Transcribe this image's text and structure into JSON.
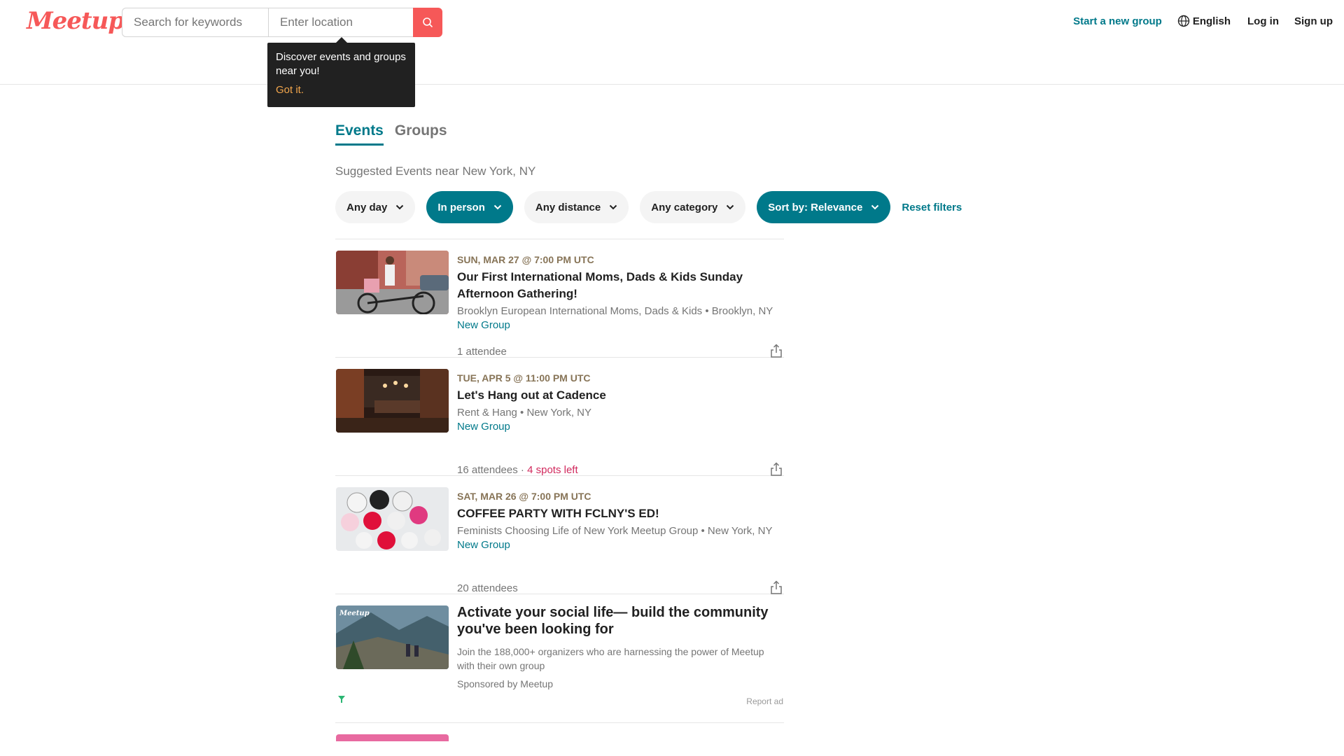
{
  "header": {
    "logo_text": "Meetup",
    "search_placeholder": "Search for keywords",
    "location_placeholder": "Enter location",
    "start_group": "Start a new group",
    "language": "English",
    "login": "Log in",
    "signup": "Sign up"
  },
  "tooltip": {
    "text": "Discover events and groups near you!",
    "action": "Got it."
  },
  "tabs": [
    {
      "label": "Events",
      "active": true
    },
    {
      "label": "Groups",
      "active": false
    }
  ],
  "subtitle": "Suggested Events near New York, NY",
  "filters": {
    "day": "Any day",
    "mode": "In person",
    "distance": "Any distance",
    "category": "Any category",
    "sort": "Sort by: Relevance",
    "reset": "Reset filters"
  },
  "events": [
    {
      "date": "SUN, MAR 27 @ 7:00 PM UTC",
      "title": "Our First International Moms, Dads & Kids Sunday Afternoon Gathering!",
      "group": "Brooklyn European International Moms, Dads & Kids • Brooklyn, NY",
      "badge": "New Group",
      "attendees": "1 attendee",
      "spots": ""
    },
    {
      "date": "TUE, APR 5 @ 11:00 PM UTC",
      "title": "Let's Hang out at Cadence",
      "group": "Rent & Hang • New York, NY",
      "badge": "New Group",
      "attendees": "16 attendees",
      "spots": "4 spots left"
    },
    {
      "date": "SAT, MAR 26 @ 7:00 PM UTC",
      "title": "COFFEE PARTY WITH FCLNY'S ED!",
      "group": "Feminists Choosing Life of New York Meetup Group • New York, NY",
      "badge": "New Group",
      "attendees": "20 attendees",
      "spots": ""
    }
  ],
  "sponsored": {
    "logo_text": "Meetup",
    "title": "Activate your social life— build the community you've been looking for",
    "description": "Join the 188,000+ organizers who are harnessing the power of Meetup with their own group",
    "by": "Sponsored by Meetup",
    "report": "Report ad"
  },
  "colors": {
    "brand": "#f65858",
    "teal": "#00798a",
    "date": "#877457",
    "spots": "#d1295d"
  }
}
